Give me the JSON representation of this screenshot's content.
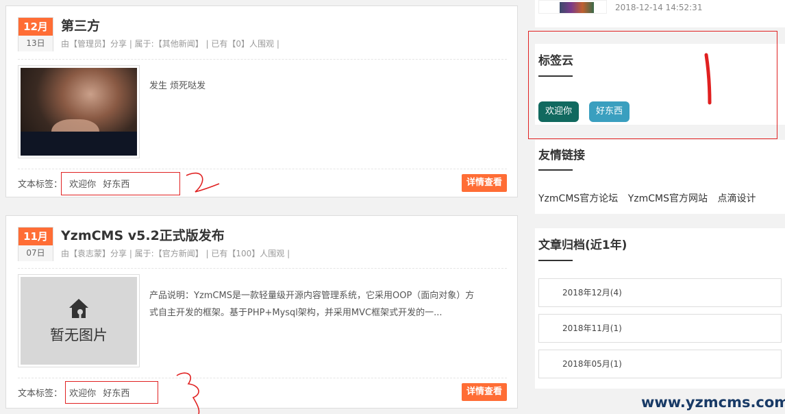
{
  "posts": [
    {
      "month": "12月",
      "day": "13日",
      "title": "第三方",
      "meta": "由【管理员】分享 | 属于:【其他新闻】 | 已有【0】人围观 |",
      "excerpt": "发生 烦死哒发",
      "tags_label": "文本标签：",
      "tags": [
        "欢迎你",
        "好东西"
      ],
      "detail_label": "详情查看"
    },
    {
      "month": "11月",
      "day": "07日",
      "title": "YzmCMS v5.2正式版发布",
      "meta": "由【袁志蒙】分享 | 属于:【官方新闻】 | 已有【100】人围观 |",
      "excerpt_line1": "产品说明：YzmCMS是一款轻量级开源内容管理系统，它采用OOP（面向对象）方",
      "excerpt_line2": "式自主开发的框架。基于PHP+Mysql架构，并采用MVC框架式开发的一...",
      "noimage_label": "暂无图片",
      "tags_label": "文本标签：",
      "tags": [
        "欢迎你",
        "好东西"
      ],
      "detail_label": "详情查看"
    }
  ],
  "sidebar": {
    "top_time": "2018-12-14 14:52:31",
    "tag_cloud": {
      "title": "标签云",
      "tags": [
        "欢迎你",
        "好东西"
      ],
      "tag_colors": [
        "#11695f",
        "#3a9fbf"
      ]
    },
    "links": {
      "title": "友情链接",
      "items": [
        "YzmCMS官方论坛",
        "YzmCMS官方网站",
        "点滴设计"
      ]
    },
    "archive": {
      "title": "文章归档(近1年)",
      "items": [
        "2018年12月(4)",
        "2018年11月(1)",
        "2018年05月(1)"
      ]
    }
  },
  "watermark": "www.yzmcms.com",
  "colors": {
    "accent": "#ff6d35",
    "annotation": "#e02020"
  }
}
